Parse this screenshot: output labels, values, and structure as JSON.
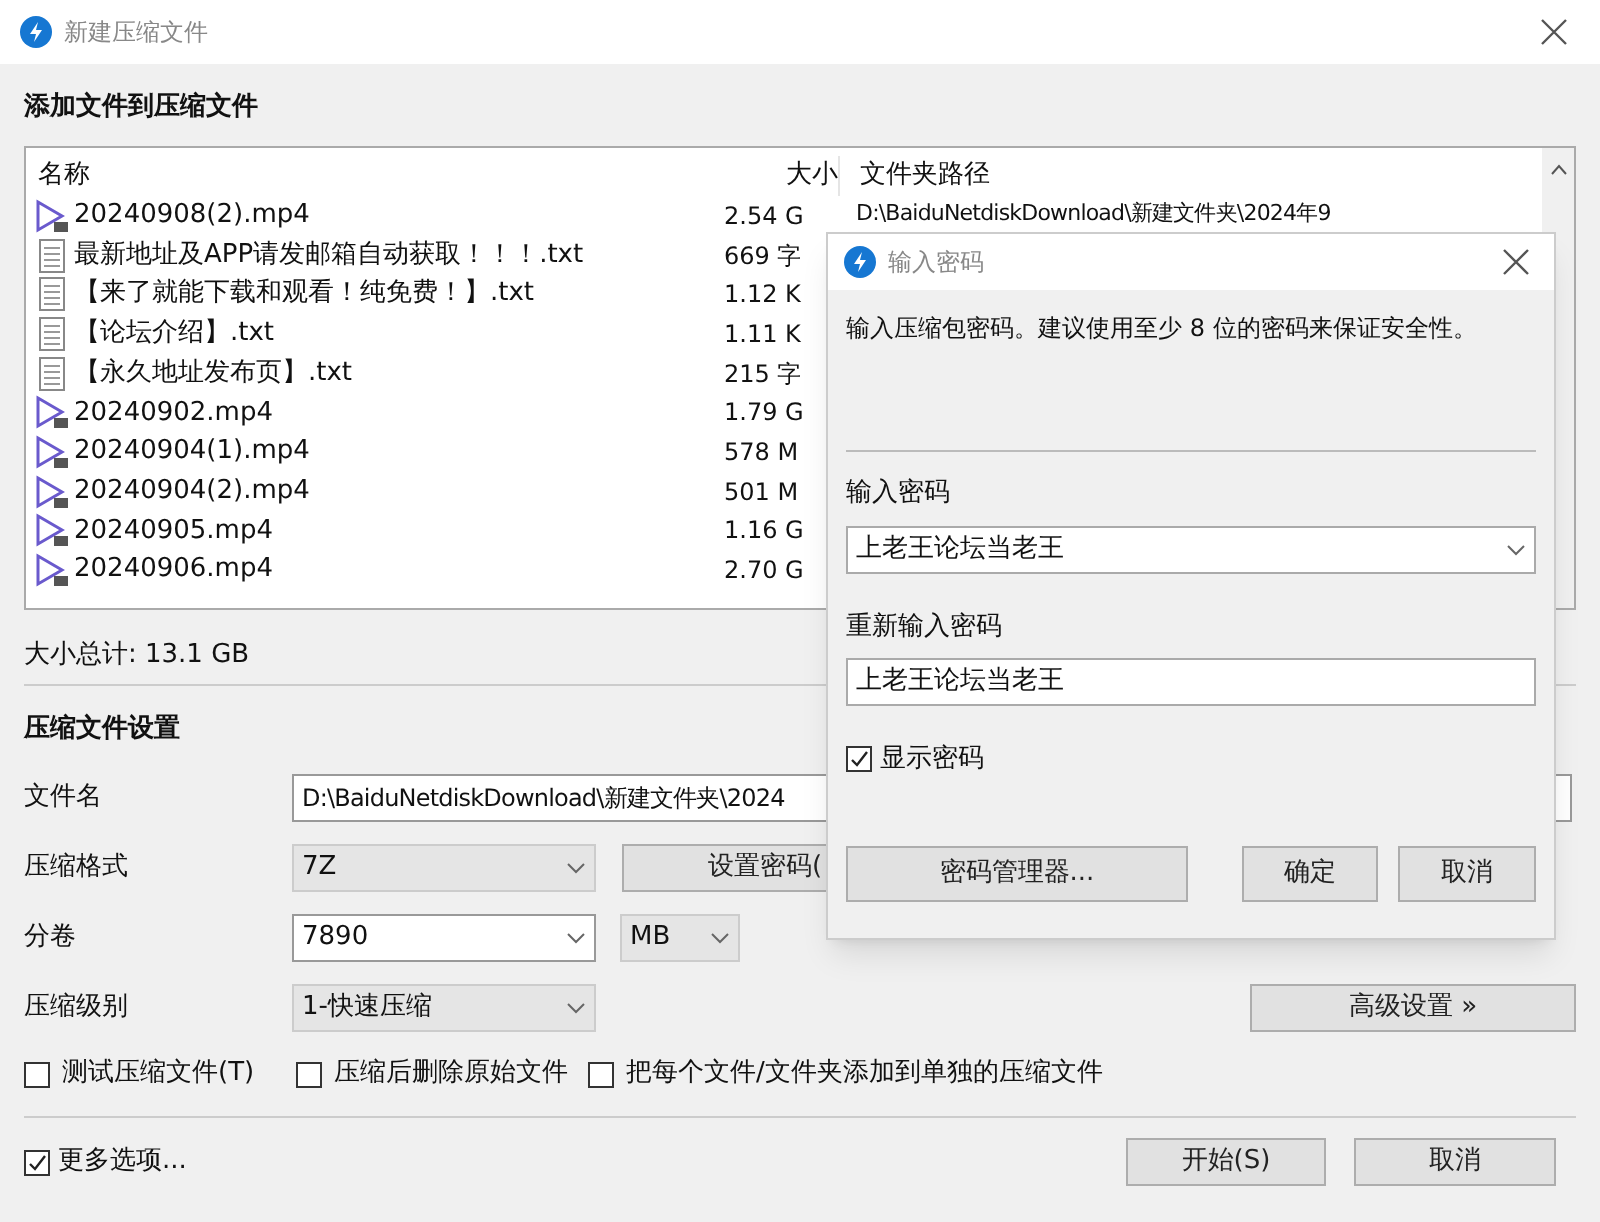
{
  "window": {
    "title": "新建压缩文件"
  },
  "files_section": {
    "heading": "添加文件到压缩文件",
    "columns": [
      "名称",
      "大小",
      "文件夹路径"
    ],
    "rows": [
      {
        "kind": "video",
        "name": "20240908(2).mp4",
        "size": "2.54 G",
        "path": "D:\\BaiduNetdiskDownload\\新建文件夹\\2024年9"
      },
      {
        "kind": "text",
        "name": "最新地址及APP请发邮箱自动获取！！！.txt",
        "size": "669 字"
      },
      {
        "kind": "text",
        "name": "【来了就能下载和观看！纯免费！】.txt",
        "size": "1.12 K"
      },
      {
        "kind": "text",
        "name": "【论坛介绍】.txt",
        "size": "1.11 K"
      },
      {
        "kind": "text",
        "name": "【永久地址发布页】.txt",
        "size": "215 字"
      },
      {
        "kind": "video",
        "name": "20240902.mp4",
        "size": "1.79 G"
      },
      {
        "kind": "video",
        "name": "20240904(1).mp4",
        "size": "578 M"
      },
      {
        "kind": "video",
        "name": "20240904(2).mp4",
        "size": "501 M"
      },
      {
        "kind": "video",
        "name": "20240905.mp4",
        "size": "1.16 G"
      },
      {
        "kind": "video",
        "name": "20240906.mp4",
        "size": "2.70 G"
      }
    ],
    "total": "大小总计: 13.1 GB"
  },
  "settings": {
    "heading": "压缩文件设置",
    "filename": {
      "label": "文件名",
      "value": "D:\\BaiduNetdiskDownload\\新建文件夹\\2024"
    },
    "format": {
      "label": "压缩格式",
      "value": "7Z",
      "button": "设置密码("
    },
    "split": {
      "label": "分卷",
      "value": "7890",
      "unit": "MB"
    },
    "level": {
      "label": "压缩级别",
      "value": "1-快速压缩",
      "button": "高级设置 »"
    },
    "options": [
      {
        "label": "测试压缩文件(T)",
        "checked": false
      },
      {
        "label": "压缩后删除原始文件",
        "checked": false
      },
      {
        "label": "把每个文件/文件夹添加到单独的压缩文件",
        "checked": false
      }
    ]
  },
  "footer": {
    "more": {
      "label": "更多选项...",
      "checked": true
    },
    "buttons": [
      "开始(S)",
      "取消"
    ]
  },
  "password_dialog": {
    "title": "输入密码",
    "message": "输入压缩包密码。建议使用至少 8 位的密码来保证安全性。",
    "password": {
      "label": "输入密码",
      "value": "上老王论坛当老王"
    },
    "confirm": {
      "label": "重新输入密码",
      "value": "上老王论坛当老王"
    },
    "show_password": {
      "label": "显示密码",
      "checked": true
    },
    "buttons": [
      "密码管理器...",
      "确定",
      "取消"
    ]
  }
}
